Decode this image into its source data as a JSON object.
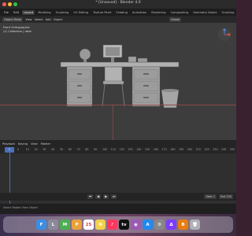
{
  "window": {
    "title": "* [Unsaved] - Blender 4.0"
  },
  "menubar": {
    "items": [
      "File",
      "Edit",
      "Render",
      "Window",
      "Help"
    ],
    "tabs": [
      "Layout",
      "Modeling",
      "Sculpting",
      "UV Editing",
      "Texture Paint",
      "Shading",
      "Animation",
      "Rendering",
      "Compositing",
      "Geometry Nodes",
      "Scripting"
    ],
    "active_tab": "Layout"
  },
  "header": {
    "mode": "Object Mode",
    "items": [
      "View",
      "Select",
      "Add",
      "Object"
    ],
    "orientation": "Global"
  },
  "viewport": {
    "info_line1": "Front Orthographic",
    "info_line2": "(1) Collection | desk"
  },
  "timeline": {
    "menus": [
      "Playback",
      "Keying",
      "View",
      "Marker"
    ],
    "current_frame": "1",
    "ticks": [
      "0",
      "10",
      "20",
      "30",
      "40",
      "50",
      "60",
      "70",
      "80",
      "90",
      "100",
      "110",
      "120",
      "130",
      "140",
      "150",
      "160",
      "170",
      "180",
      "190",
      "200",
      "210",
      "220",
      "230",
      "240",
      "250"
    ],
    "start_label": "Start",
    "start_value": "1",
    "end_label": "End",
    "end_value": "250"
  },
  "statusbar": {
    "text": "Select   Rotate View   Object"
  },
  "dock": {
    "apps": [
      {
        "name": "finder",
        "color": "#3a8ee6",
        "glyph": "F"
      },
      {
        "name": "launchpad",
        "color": "#8a8a9a",
        "glyph": "L"
      },
      {
        "name": "maps",
        "color": "#4caf50",
        "glyph": "M"
      },
      {
        "name": "photos",
        "color": "#e9a23b",
        "glyph": "P"
      },
      {
        "name": "calendar",
        "color": "#ffffff",
        "glyph": "25"
      },
      {
        "name": "notes",
        "color": "#f2d04b",
        "glyph": "N"
      },
      {
        "name": "music",
        "color": "#ff375f",
        "glyph": "♪"
      },
      {
        "name": "tv",
        "color": "#111111",
        "glyph": "tv"
      },
      {
        "name": "podcasts",
        "color": "#9b59b6",
        "glyph": "◉"
      },
      {
        "name": "appstore",
        "color": "#1f8bf0",
        "glyph": "A"
      },
      {
        "name": "settings",
        "color": "#888888",
        "glyph": "⚙"
      },
      {
        "name": "affinity",
        "color": "#7d3cff",
        "glyph": "Δ"
      },
      {
        "name": "blender",
        "color": "#e87d0d",
        "glyph": "B"
      },
      {
        "name": "trash",
        "color": "#b0b0b8",
        "glyph": "🗑"
      }
    ]
  }
}
